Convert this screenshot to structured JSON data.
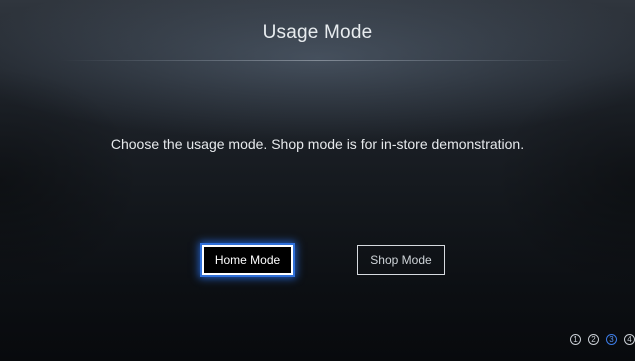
{
  "screen": {
    "title": "Usage Mode",
    "description": "Choose the usage mode. Shop mode is for in-store demonstration."
  },
  "buttons": {
    "home_mode": "Home Mode",
    "shop_mode": "Shop Mode"
  },
  "steps": {
    "items": [
      "1",
      "2",
      "3",
      "4"
    ],
    "current": 3
  },
  "colors": {
    "focus_accent": "#2f6fd9",
    "active_step": "#3b7be6"
  }
}
